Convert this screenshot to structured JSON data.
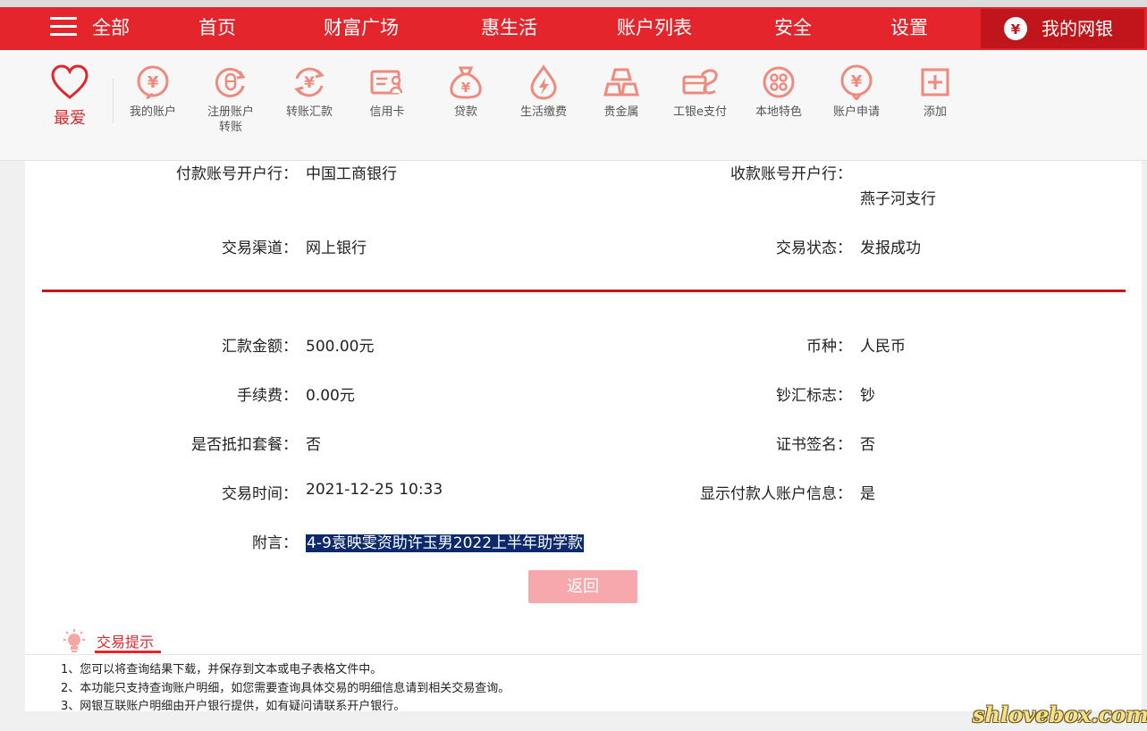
{
  "nav": {
    "all_label": "全部",
    "items": [
      "首页",
      "财富广场",
      "惠生活",
      "账户列表",
      "安全",
      "设置"
    ],
    "netbank_label": "我的网银",
    "netbank_icon": "money-bag-icon",
    "accent_color": "#e4262c"
  },
  "shortcuts": {
    "favorite_label": "最爱",
    "items": [
      {
        "label": "我的账户",
        "icon": "yen-circle-icon"
      },
      {
        "label": "注册账户\n转账",
        "icon": "refresh-coin-icon"
      },
      {
        "label": "转账汇款",
        "icon": "transfer-yen-icon"
      },
      {
        "label": "信用卡",
        "icon": "credit-card-icon"
      },
      {
        "label": "贷款",
        "icon": "money-bag-icon"
      },
      {
        "label": "生活缴费",
        "icon": "bolt-drop-icon"
      },
      {
        "label": "贵金属",
        "icon": "gold-bars-icon"
      },
      {
        "label": "工银e支付",
        "icon": "e-pay-icon"
      },
      {
        "label": "本地特色",
        "icon": "local-dots-icon"
      },
      {
        "label": "账户申请",
        "icon": "apply-yen-icon"
      },
      {
        "label": "添加",
        "icon": "plus-box-icon"
      }
    ]
  },
  "details": {
    "payer_bank_label": "付款账号开户行：",
    "payer_bank_value": "中国工商银行",
    "payee_bank_label": "收款账号开户行：",
    "payee_bank_value": "燕子河支行",
    "channel_label": "交易渠道：",
    "channel_value": "网上银行",
    "status_label": "交易状态：",
    "status_value": "发报成功",
    "amount_label": "汇款金额：",
    "amount_value": "500.00元",
    "currency_label": "币种：",
    "currency_value": "人民币",
    "fee_label": "手续费：",
    "fee_value": "0.00元",
    "cash_flag_label": "钞汇标志：",
    "cash_flag_value": "钞",
    "package_label": "是否抵扣套餐：",
    "package_value": "否",
    "cert_label": "证书签名：",
    "cert_value": "否",
    "time_label": "交易时间：",
    "time_value": "2021-12-25 10:33",
    "show_payer_label": "显示付款人账户信息：",
    "show_payer_value": "是",
    "memo_label": "附言：",
    "memo_value": "4-9袁映雯资助许玉男2022上半年助学款",
    "back_button": "返回"
  },
  "tips": {
    "title": "交易提示",
    "items": [
      "1、您可以将查询结果下载，并保存到文本或电子表格文件中。",
      "2、本功能只支持查询账户明细，如您需要查询具体交易的明细信息请到相关交易查询。",
      "3、网银互联账户明细由开户银行提供，如有疑问请联系开户银行。"
    ]
  },
  "watermark": "shlovebox.com"
}
